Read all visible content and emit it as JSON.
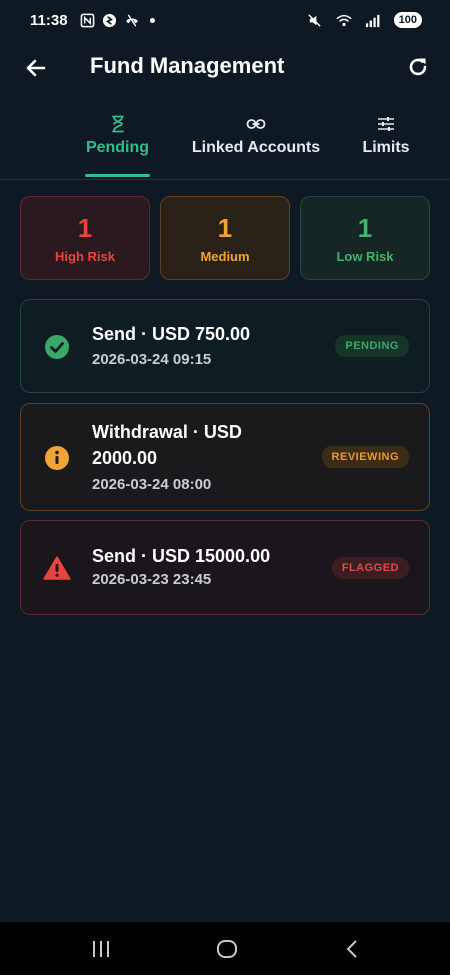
{
  "status_bar": {
    "time": "11:38",
    "battery": "100",
    "left_icons": [
      "nfc-icon",
      "shazam-icon",
      "call-icon",
      "dot"
    ],
    "right_icons": [
      "mute-icon",
      "wifi-icon",
      "signal-icon"
    ]
  },
  "app_bar": {
    "title": "Fund Management",
    "back_icon": "arrow-left-icon",
    "refresh_icon": "refresh-icon"
  },
  "tabs": [
    {
      "label": "Pending",
      "icon": "hourglass-icon",
      "active": true
    },
    {
      "label": "Linked Accounts",
      "icon": "link-icon",
      "active": false
    },
    {
      "label": "Limits",
      "icon": "sliders-icon",
      "active": false
    }
  ],
  "risk_summary": [
    {
      "count": "1",
      "label": "High Risk",
      "color": "#e8443f"
    },
    {
      "count": "1",
      "label": "Medium",
      "color": "#f1a436"
    },
    {
      "count": "1",
      "label": "Low Risk",
      "color": "#45b36b"
    }
  ],
  "transactions": [
    {
      "title": "Send · USD 750.00",
      "time": "2026-03-24 09:15",
      "status": "PENDING",
      "icon": "check-circle-icon",
      "color": "#3aa86a"
    },
    {
      "title": "Withdrawal · USD 2000.00",
      "time": "2026-03-24 08:00",
      "status": "REVIEWING",
      "icon": "info-circle-icon",
      "color": "#e89a32"
    },
    {
      "title": "Send · USD 15000.00",
      "time": "2026-03-23 23:45",
      "status": "FLAGGED",
      "icon": "warning-triangle-icon",
      "color": "#e04a45"
    }
  ],
  "nav_bar": {
    "icons": [
      "recent-apps-icon",
      "home-icon",
      "back-icon"
    ]
  },
  "colors": {
    "background": "#0f1923",
    "accent": "#2fbf8f"
  }
}
